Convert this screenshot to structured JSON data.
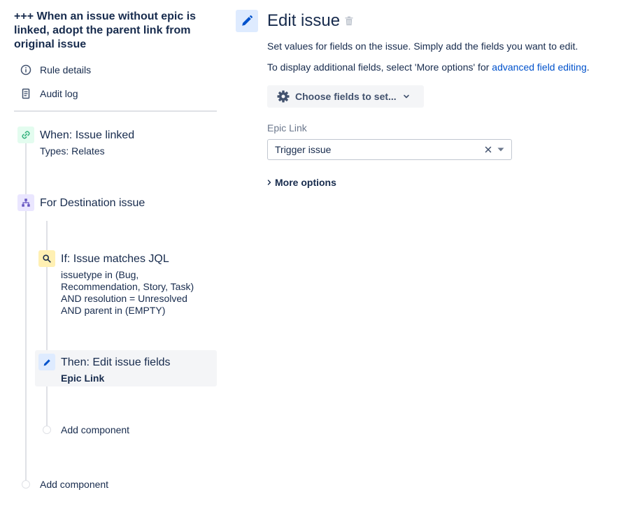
{
  "rule": {
    "title": "+++ When an issue without epic is linked, adopt the parent link from original issue",
    "nav": [
      {
        "label": "Rule details",
        "icon": "info-icon"
      },
      {
        "label": "Audit log",
        "icon": "document-icon"
      }
    ]
  },
  "flow": {
    "trigger": {
      "title": "When: Issue linked",
      "subtitle": "Types: Relates",
      "icon": "link-icon",
      "color": "#36b37e"
    },
    "branch": {
      "title": "For Destination issue",
      "icon": "hierarchy-icon",
      "color": "#6554c0"
    },
    "condition": {
      "title": "If: Issue matches JQL",
      "lines": [
        "issuetype in (Bug,",
        "Recommendation, Story, Task)",
        "AND resolution = Unresolved",
        "AND parent in (EMPTY)"
      ],
      "icon": "search-icon",
      "color": "#ffc400"
    },
    "action": {
      "title": "Then: Edit issue fields",
      "subtitle": "Epic Link",
      "icon": "pencil-icon",
      "color": "#0052cc"
    },
    "add_component_inner": "Add component",
    "add_component_outer": "Add component"
  },
  "editor": {
    "title": "Edit issue",
    "desc1": "Set values for fields on the issue. Simply add the fields you want to edit.",
    "desc2_prefix": "To display additional fields, select 'More options' for ",
    "desc2_link": "advanced field editing",
    "desc2_suffix": ".",
    "choose_fields": "Choose fields to set...",
    "field_label": "Epic Link",
    "field_value": "Trigger issue",
    "more_options": "More options"
  },
  "colors": {
    "accent": "#0052cc",
    "text": "#172b4d",
    "muted": "#6b778c"
  }
}
